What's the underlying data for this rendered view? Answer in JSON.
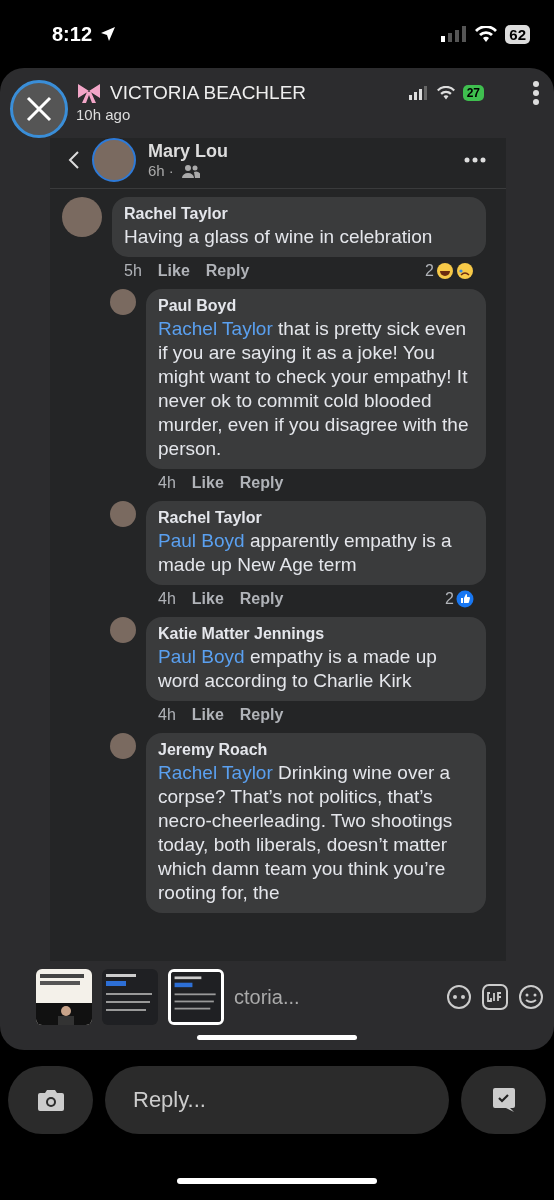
{
  "status_bar": {
    "time": "8:12",
    "battery": "62"
  },
  "story": {
    "title": "VICTORIA BEACHLER",
    "age": "10h ago",
    "inner_battery": "27"
  },
  "post": {
    "author": "Mary Lou",
    "meta": "6h ·"
  },
  "comments": [
    {
      "author": "Rachel Taylor",
      "text": "Having a glass of wine in celebration",
      "time": "5h",
      "like": "Like",
      "reply": "Reply",
      "reaction_count": "2",
      "reactions": [
        {
          "kind": "haha"
        },
        {
          "kind": "sad"
        }
      ],
      "children": [
        {
          "author": "Paul Boyd",
          "mention": "Rachel Taylor",
          "text": " that is pretty sick even if you are saying it as a joke! You might want to check your empathy!    It never ok to commit cold blooded murder, even if you disagree with the person.",
          "time": "4h",
          "like": "Like",
          "reply": "Reply"
        },
        {
          "author": "Rachel Taylor",
          "mention": "Paul Boyd",
          "text": " apparently empathy is a made up New Age term",
          "time": "4h",
          "like": "Like",
          "reply": "Reply",
          "reaction_count": "2",
          "reactions": [
            {
              "kind": "like"
            }
          ]
        },
        {
          "author": "Katie Matter Jennings",
          "mention": "Paul Boyd",
          "text": " empathy is a made up word according to Charlie Kirk",
          "time": "4h",
          "like": "Like",
          "reply": "Reply"
        },
        {
          "author": "Jeremy Roach",
          "mention": "Rachel Taylor",
          "text": " Drinking wine over a corpse? That’s not politics, that’s necro-cheerleading. Two shootings today, both liberals, doesn’t matter which damn team you think you’re rooting for, the"
        }
      ]
    }
  ],
  "comment_bar": {
    "placeholder": "ctoria..."
  },
  "thumbnails": [
    {
      "kind": "picture",
      "selected": false
    },
    {
      "kind": "picture",
      "selected": false
    },
    {
      "kind": "picture",
      "selected": true
    }
  ],
  "reply_bar": {
    "placeholder": "Reply..."
  }
}
